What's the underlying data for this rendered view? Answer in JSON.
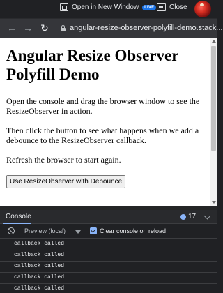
{
  "topbar": {
    "open_new_window_label": "Open in New Window",
    "live_badge": "LIVE",
    "close_label": "Close"
  },
  "address_bar": {
    "url": "angular-resize-observer-polyfill-demo.stack..."
  },
  "page": {
    "heading": "Angular Resize Observer Polyfill Demo",
    "paragraphs": [
      "Open the console and drag the browser window to see the ResizeObserver in action.",
      "Then click the button to see what happens when we add a debounce to the ResizeObserver callback.",
      "Refresh the browser to start again."
    ],
    "button_label": "Use ResizeObserver with Debounce"
  },
  "devtools": {
    "tab_label": "Console",
    "issue_count": "17",
    "context_label": "Preview (local)",
    "clear_on_reload_label": "Clear console on reload",
    "clear_on_reload_checked": true,
    "log_messages": [
      "callback called",
      "callback called",
      "callback called",
      "callback called",
      "callback called"
    ]
  },
  "colors": {
    "accent": "#8ab4f8",
    "devtools_bg": "#202124",
    "live_badge": "#1a73e8"
  }
}
